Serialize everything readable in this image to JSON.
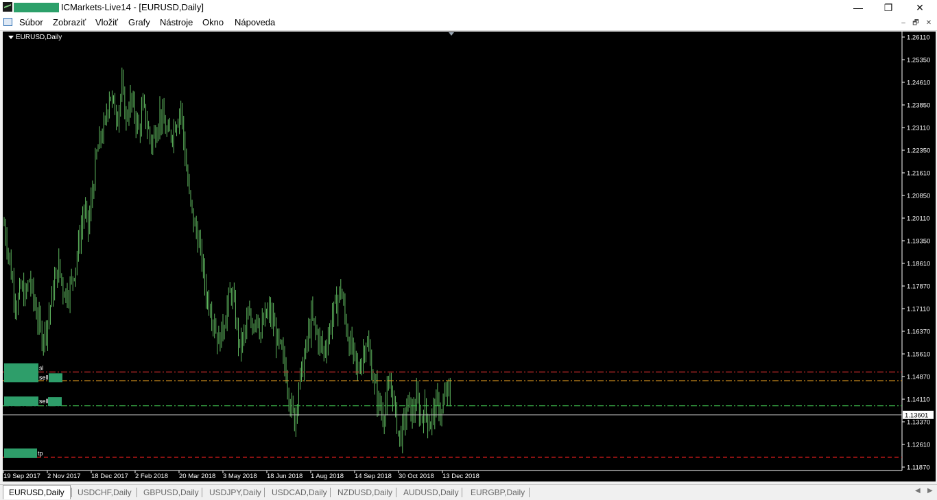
{
  "window": {
    "title": "ICMarkets-Live14 - [EURUSD,Daily]",
    "buttons": {
      "minimize": "—",
      "maximize": "❐",
      "close": "✕"
    }
  },
  "menu": {
    "items": [
      "Súbor",
      "Zobraziť",
      "Vložiť",
      "Grafy",
      "Nástroje",
      "Okno",
      "Nápoveda"
    ],
    "mdi_buttons": {
      "minimize": "–",
      "restore": "🗗",
      "close": "✕"
    }
  },
  "chart": {
    "label": "EURUSD,Daily",
    "background": "#000000",
    "bar_color": "#5fb85f",
    "axis_color": "#ffffff"
  },
  "chart_data": {
    "type": "ohlc",
    "symbol": "EURUSD",
    "timeframe": "Daily",
    "ylim": [
      1.1187,
      1.2611
    ],
    "price_ticks": [
      "1.26110",
      "1.25350",
      "1.24610",
      "1.23850",
      "1.23110",
      "1.22350",
      "1.21610",
      "1.20850",
      "1.20110",
      "1.19350",
      "1.18610",
      "1.17870",
      "1.17110",
      "1.16370",
      "1.15610",
      "1.14870",
      "1.14110",
      "1.13370",
      "1.12610",
      "1.11870"
    ],
    "date_ticks": [
      "19 Sep 2017",
      "2 Nov 2017",
      "18 Dec 2017",
      "2 Feb 2018",
      "20 Mar 2018",
      "3 May 2018",
      "18 Jun 2018",
      "1 Aug 2018",
      "14 Sep 2018",
      "30 Oct 2018",
      "13 Dec 2018"
    ],
    "current_price": "1.13601",
    "close_path": [
      [
        0,
        1.199
      ],
      [
        3,
        1.19
      ],
      [
        6,
        1.18
      ],
      [
        9,
        1.172
      ],
      [
        12,
        1.178
      ],
      [
        15,
        1.175
      ],
      [
        18,
        1.181
      ],
      [
        21,
        1.174
      ],
      [
        24,
        1.168
      ],
      [
        27,
        1.162
      ],
      [
        30,
        1.165
      ],
      [
        33,
        1.172
      ],
      [
        36,
        1.18
      ],
      [
        39,
        1.185
      ],
      [
        42,
        1.178
      ],
      [
        45,
        1.176
      ],
      [
        48,
        1.18
      ],
      [
        51,
        1.186
      ],
      [
        54,
        1.195
      ],
      [
        57,
        1.204
      ],
      [
        60,
        1.198
      ],
      [
        63,
        1.21
      ],
      [
        66,
        1.222
      ],
      [
        69,
        1.228
      ],
      [
        72,
        1.232
      ],
      [
        75,
        1.243
      ],
      [
        78,
        1.238
      ],
      [
        81,
        1.236
      ],
      [
        84,
        1.244
      ],
      [
        87,
        1.234
      ],
      [
        90,
        1.24
      ],
      [
        93,
        1.236
      ],
      [
        96,
        1.23
      ],
      [
        99,
        1.238
      ],
      [
        102,
        1.232
      ],
      [
        105,
        1.226
      ],
      [
        108,
        1.23
      ],
      [
        111,
        1.236
      ],
      [
        114,
        1.232
      ],
      [
        117,
        1.228
      ],
      [
        120,
        1.23
      ],
      [
        123,
        1.234
      ],
      [
        126,
        1.238
      ],
      [
        129,
        1.222
      ],
      [
        132,
        1.208
      ],
      [
        135,
        1.2
      ],
      [
        138,
        1.195
      ],
      [
        141,
        1.187
      ],
      [
        144,
        1.176
      ],
      [
        147,
        1.172
      ],
      [
        150,
        1.166
      ],
      [
        153,
        1.16
      ],
      [
        156,
        1.165
      ],
      [
        159,
        1.172
      ],
      [
        162,
        1.177
      ],
      [
        165,
        1.168
      ],
      [
        168,
        1.158
      ],
      [
        171,
        1.162
      ],
      [
        174,
        1.168
      ],
      [
        177,
        1.166
      ],
      [
        180,
        1.17
      ],
      [
        183,
        1.163
      ],
      [
        186,
        1.168
      ],
      [
        189,
        1.17
      ],
      [
        192,
        1.166
      ],
      [
        195,
        1.16
      ],
      [
        198,
        1.156
      ],
      [
        201,
        1.15
      ],
      [
        204,
        1.14
      ],
      [
        207,
        1.134
      ],
      [
        210,
        1.146
      ],
      [
        213,
        1.152
      ],
      [
        216,
        1.16
      ],
      [
        219,
        1.168
      ],
      [
        222,
        1.164
      ],
      [
        225,
        1.16
      ],
      [
        228,
        1.157
      ],
      [
        231,
        1.162
      ],
      [
        234,
        1.169
      ],
      [
        237,
        1.173
      ],
      [
        240,
        1.178
      ],
      [
        243,
        1.168
      ],
      [
        246,
        1.16
      ],
      [
        249,
        1.156
      ],
      [
        252,
        1.15
      ],
      [
        255,
        1.155
      ],
      [
        258,
        1.161
      ],
      [
        261,
        1.154
      ],
      [
        264,
        1.146
      ],
      [
        267,
        1.14
      ],
      [
        270,
        1.136
      ],
      [
        273,
        1.142
      ],
      [
        276,
        1.146
      ],
      [
        279,
        1.136
      ],
      [
        282,
        1.128
      ],
      [
        285,
        1.133
      ],
      [
        288,
        1.14
      ],
      [
        291,
        1.136
      ],
      [
        294,
        1.141
      ],
      [
        297,
        1.135
      ],
      [
        300,
        1.138
      ],
      [
        303,
        1.133
      ],
      [
        306,
        1.137
      ],
      [
        309,
        1.14
      ],
      [
        312,
        1.136
      ],
      [
        315,
        1.144
      ],
      [
        318,
        1.142
      ]
    ],
    "levels": [
      {
        "name": "sl",
        "price": 1.1502,
        "color": "#e03030",
        "style": "dash-dot"
      },
      {
        "name": "sell",
        "price": 1.1473,
        "color": "#e8a020",
        "style": "dash-dot"
      },
      {
        "name": "sell",
        "price": 1.139,
        "color": "#3cb34a",
        "style": "dash-dot"
      },
      {
        "name": "tp",
        "price": 1.122,
        "color": "#ff2020",
        "style": "dashed"
      }
    ],
    "bid_line": {
      "price": 1.136,
      "color": "#c0c0c0"
    },
    "label_box_color": "#2e9e6a"
  },
  "tabs": [
    {
      "label": "EURUSD,Daily",
      "active": true
    },
    {
      "label": "USDCHF,Daily",
      "active": false
    },
    {
      "label": "GBPUSD,Daily",
      "active": false
    },
    {
      "label": "USDJPY,Daily",
      "active": false
    },
    {
      "label": "USDCAD,Daily",
      "active": false
    },
    {
      "label": "NZDUSD,Daily",
      "active": false
    },
    {
      "label": "AUDUSD,Daily",
      "active": false
    },
    {
      "label": "EURGBP,Daily",
      "active": false
    }
  ],
  "tab_scroll": {
    "left": "◀",
    "right": "▶"
  }
}
